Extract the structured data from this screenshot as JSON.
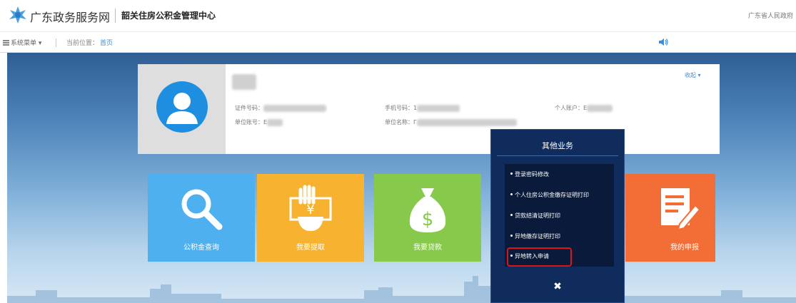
{
  "header": {
    "site_name": "广东政务服务网",
    "center_name": "韶关住房公积金管理中心",
    "gov_link": "广东省人民政府"
  },
  "navbar": {
    "menu_label": "系统菜单",
    "menu_caret": "▾",
    "breadcrumb_label": "当前位置：",
    "breadcrumb_current": "首页"
  },
  "profile": {
    "id_label": "证件号码：",
    "unit_acct_label": "单位账号：",
    "unit_acct_partial": "E",
    "phone_label": "手机号码：",
    "phone_partial": "1",
    "unit_name_label": "单位名称：",
    "unit_name_partial": "Г",
    "personal_acct_label": "个人账户：",
    "personal_acct_partial": "E",
    "collapse_label": "收起",
    "collapse_caret": "▾"
  },
  "tiles": [
    {
      "label": "公积金查询",
      "icon": "magnifier-icon",
      "color": "#4fb0ef"
    },
    {
      "label": "我要提取",
      "icon": "cash-withdraw-icon",
      "color": "#f7b22f"
    },
    {
      "label": "我要贷款",
      "icon": "money-bag-icon",
      "color": "#86c94b"
    },
    {
      "label": "我的申报",
      "icon": "document-edit-icon",
      "color": "#f36e36"
    }
  ],
  "popup": {
    "title": "其他业务",
    "items": [
      "登录密码修改",
      "个人住房公积金缴存证明打印",
      "贷款结清证明打印",
      "异地缴存证明打印",
      "异地转入申请"
    ],
    "highlighted_item": "异地转入申请",
    "close_glyph": "✖"
  },
  "colors": {
    "accent": "#1e8fe0",
    "popup_bg": "#0f2c5c",
    "highlight": "#e01414"
  }
}
